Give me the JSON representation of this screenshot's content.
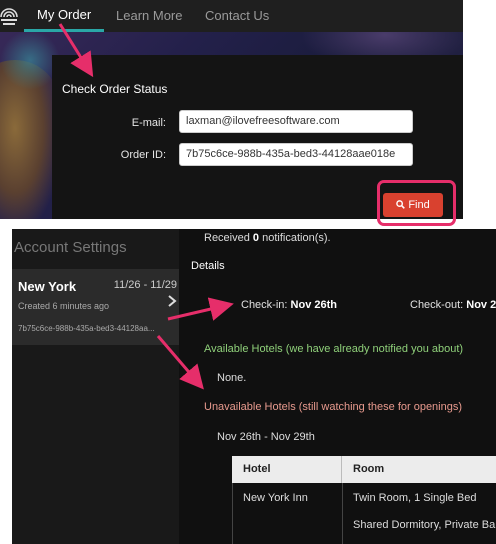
{
  "nav": {
    "items": [
      {
        "label": "My Order"
      },
      {
        "label": "Learn More"
      },
      {
        "label": "Contact Us"
      }
    ]
  },
  "order_status": {
    "title": "Check Order Status",
    "email_label": "E-mail:",
    "email_value": "laxman@ilovefreesoftware.com",
    "order_id_label": "Order ID:",
    "order_id_value": "7b75c6ce-988b-435a-bed3-44128aae018e",
    "find_label": "Find"
  },
  "sidebar": {
    "title": "Account Settings",
    "order": {
      "city": "New York",
      "dates": "11/26 - 11/29",
      "created": "Created 6 minutes ago",
      "id": "7b75c6ce-988b-435a-bed3-44128aa..."
    }
  },
  "details": {
    "notif_prefix": "Received",
    "notif_count": "0",
    "notif_suffix": "notification(s).",
    "title": "Details",
    "checkin_label": "Check-in:",
    "checkin_value": "Nov 26th",
    "checkout_label": "Check-out:",
    "checkout_value": "Nov 2",
    "available_title": "Available Hotels (we have already notified you about)",
    "available_none": "None.",
    "unavailable_title": "Unavailable Hotels (still watching these for openings)",
    "date_range": "Nov 26th - Nov 29th",
    "table": {
      "headers": [
        "Hotel",
        "Room"
      ],
      "rows": [
        {
          "hotel": "New York Inn",
          "room": "Twin Room, 1 Single Bed"
        },
        {
          "hotel": "",
          "room": "Shared Dormitory, Private Ba"
        }
      ]
    }
  },
  "colors": {
    "accent_teal": "#2aa7a7",
    "find_button": "#d9412f",
    "annotation_pink": "#e62e6a",
    "available_green": "#8fd07a",
    "unavailable_salmon": "#e89a8e"
  },
  "icons": [
    "logo-icon",
    "search-icon",
    "chevron-right-icon"
  ]
}
